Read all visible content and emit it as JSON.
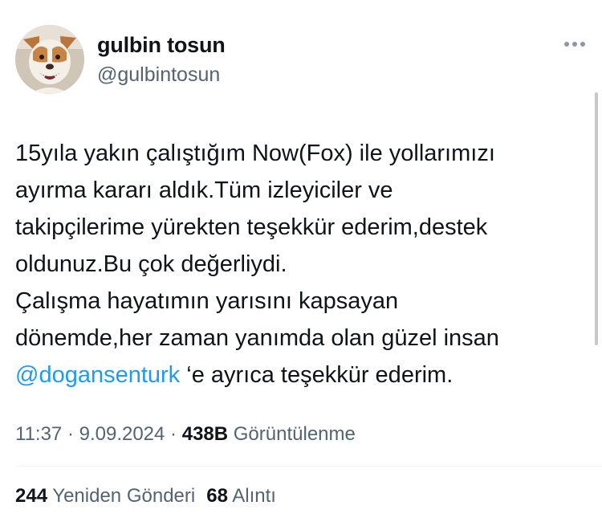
{
  "author": {
    "name": "gulbin tosun",
    "handle": "@gulbintosun",
    "avatar_icon": "dog-avatar"
  },
  "tweet": {
    "lines": [
      "15yıla yakın çalıştığım Now(Fox) ile yollarımızı",
      "ayırma kararı aldık.Tüm izleyiciler ve",
      "takipçilerime yürekten teşekkür ederim,destek",
      "oldunuz.Bu çok değerliydi.",
      "Çalışma hayatımın yarısını kapsayan",
      "dönemde,her zaman yanımda olan güzel insan"
    ],
    "mention": "@dogansenturk",
    "last_line_rest": " ‘e ayrıca teşekkür ederim."
  },
  "meta": {
    "time": "11:37",
    "separator": " · ",
    "date": "9.09.2024",
    "views_count": "438B",
    "views_label": "Görüntülenme"
  },
  "stats": {
    "reposts_count": "244",
    "reposts_label": "Yeniden Gönderi",
    "quotes_count": "68",
    "quotes_label": "Alıntı"
  },
  "colors": {
    "text": "#0f1419",
    "secondary": "#536471",
    "link": "#1d9bf0"
  }
}
